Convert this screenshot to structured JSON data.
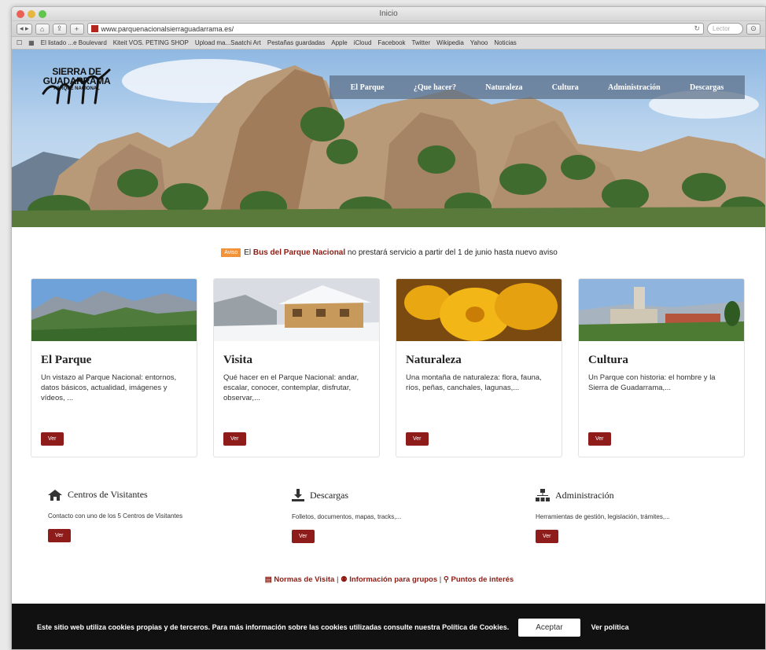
{
  "window": {
    "title": "Inicio"
  },
  "browser": {
    "url": "www.parquenacionalsierraguadarrama.es/",
    "search_placeholder": "Lector",
    "bookmarks": [
      "El listado ...e Boulevard",
      "Kiteit VOS. PETING SHOP",
      "Upload ma...Saatchi Art",
      "Pestañas guardadas",
      "Apple",
      "iCloud",
      "Facebook",
      "Twitter",
      "Wikipedia",
      "Yahoo",
      "Noticias"
    ]
  },
  "logo": {
    "line1": "SIERRA DE",
    "line2": "GUADARRAMA",
    "line3": "PARQUE NACIONAL"
  },
  "nav": [
    "El Parque",
    "¿Que hacer?",
    "Naturaleza",
    "Cultura",
    "Administración",
    "Descargas"
  ],
  "notice": {
    "badge": "Aviso",
    "prefix": "El ",
    "link": "Bus del Parque Nacional",
    "text": " no prestará servicio a partir del 1 de junio hasta nuevo aviso"
  },
  "cards": [
    {
      "title": "El Parque",
      "desc": "Un vistazo al Parque Nacional: entornos, datos básicos, actualidad, imágenes y vídeos, ...",
      "btn": "Ver"
    },
    {
      "title": "Visita",
      "desc": "Qué hacer en el Parque Nacional: andar, escalar, conocer, contemplar, disfrutar, observar,...",
      "btn": "Ver"
    },
    {
      "title": "Naturaleza",
      "desc": "Una montaña de naturaleza: flora, fauna, ríos, peñas, canchales, lagunas,...",
      "btn": "Ver"
    },
    {
      "title": "Cultura",
      "desc": "Un Parque con historia: el hombre y la Sierra de Guadarrama,...",
      "btn": "Ver"
    }
  ],
  "features": [
    {
      "title": "Centros de Visitantes",
      "desc": "Contacto con uno de los 5 Centros de Visitantes",
      "btn": "Ver"
    },
    {
      "title": "Descargas",
      "desc": "Folletos, documentos, mapas, tracks,...",
      "btn": "Ver"
    },
    {
      "title": "Administración",
      "desc": "Herramientas de gestión, legislación, trámites,...",
      "btn": "Ver"
    }
  ],
  "links": [
    "Normas de Visita",
    "Información para grupos",
    "Puntos de interés"
  ],
  "cookie": {
    "text": "Este sitio web utiliza cookies propias y de terceros. Para más información sobre las cookies utilizadas consulte nuestra Política de Cookies.",
    "accept": "Aceptar",
    "policy": "Ver política"
  }
}
